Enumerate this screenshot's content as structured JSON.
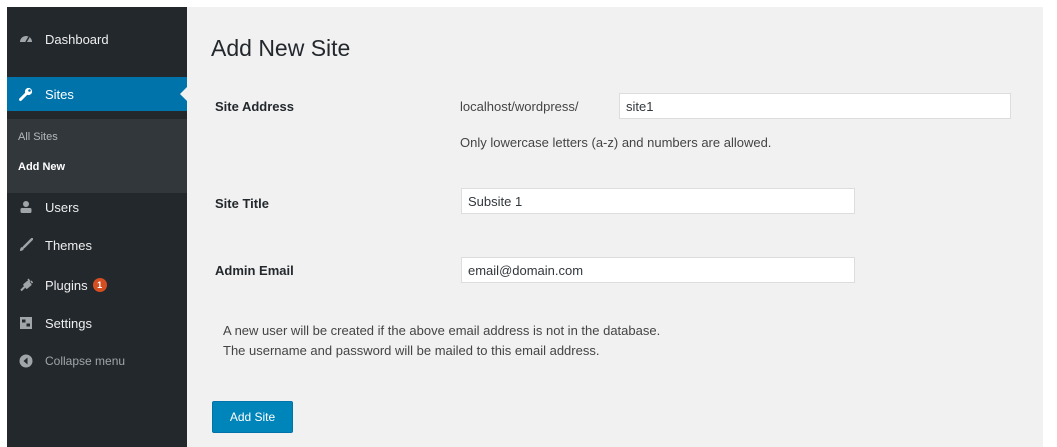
{
  "sidebar": {
    "menu": {
      "dashboard": "Dashboard",
      "sites": "Sites",
      "users": "Users",
      "themes": "Themes",
      "plugins": "Plugins",
      "plugins_badge": "1",
      "settings": "Settings",
      "collapse": "Collapse menu"
    },
    "submenu": {
      "all_sites": "All Sites",
      "add_new": "Add New"
    },
    "icons": {
      "dashboard": "dashboard-icon",
      "sites": "wrench-icon",
      "users": "users-icon",
      "themes": "brush-icon",
      "plugins": "plug-icon",
      "settings": "settings-icon",
      "collapse": "collapse-icon"
    }
  },
  "main": {
    "title": "Add New Site",
    "site_address": {
      "label": "Site Address",
      "prefix": "localhost/wordpress/",
      "value": "site1",
      "hint": "Only lowercase letters (a-z) and numbers are allowed."
    },
    "site_title": {
      "label": "Site Title",
      "value": "Subsite 1"
    },
    "admin_email": {
      "label": "Admin Email",
      "value": "email@domain.com"
    },
    "notice_line1": "A new user will be created if the above email address is not in the database.",
    "notice_line2": "The username and password will be mailed to this email address.",
    "submit": "Add Site"
  },
  "colors": {
    "sidebar_bg": "#23282d",
    "submenu_bg": "#32373c",
    "accent": "#0073aa",
    "button": "#0085ba",
    "badge": "#d54e21",
    "content_bg": "#f1f1f1"
  }
}
